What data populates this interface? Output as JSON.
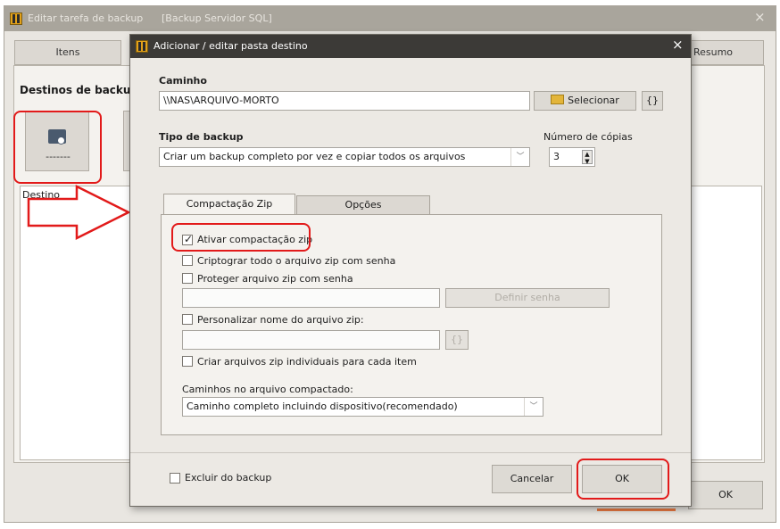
{
  "background_window": {
    "title": "Editar tarefa de backup",
    "subtitle": "[Backup Servidor SQL]",
    "close": "×",
    "tabs": [
      "Itens",
      "Resumo"
    ],
    "section_title": "Destinos de backup",
    "add_button_caption": "-------",
    "list_header": "Destino",
    "ok_label": "OK"
  },
  "dialog": {
    "title": "Adicionar / editar pasta destino",
    "close": "×",
    "path_label": "Caminho",
    "path_value": "\\\\NAS\\ARQUIVO-MORTO",
    "select_button": "Selecionar",
    "braces_button": "{}",
    "backup_type_label": "Tipo de backup",
    "backup_type_value": "Criar um backup completo por vez e copiar todos os arquivos",
    "copies_label": "Número de cópias",
    "copies_value": "3",
    "tabs": [
      "Compactação Zip",
      "Opções"
    ],
    "zip": {
      "enable_label": "Ativar compactação zip",
      "enable_checked": true,
      "encrypt_label": "Criptograr todo o arquivo zip com senha",
      "protect_label": "Proteger arquivo zip com senha",
      "set_password_button": "Definir senha",
      "custom_name_label": "Personalizar nome do arquivo zip:",
      "custom_braces": "{}",
      "individual_label": "Criar arquivos zip individuais para cada item",
      "paths_label": "Caminhos no arquivo compactado:",
      "paths_value": "Caminho completo incluindo dispositivo(recomendado)"
    },
    "exclude_label": "Excluir do backup",
    "cancel_button": "Cancelar",
    "ok_button": "OK"
  },
  "colors": {
    "highlight": "#e21a1a",
    "title_bar": "#3c3a37",
    "accent_icon": "#e3a21a"
  }
}
